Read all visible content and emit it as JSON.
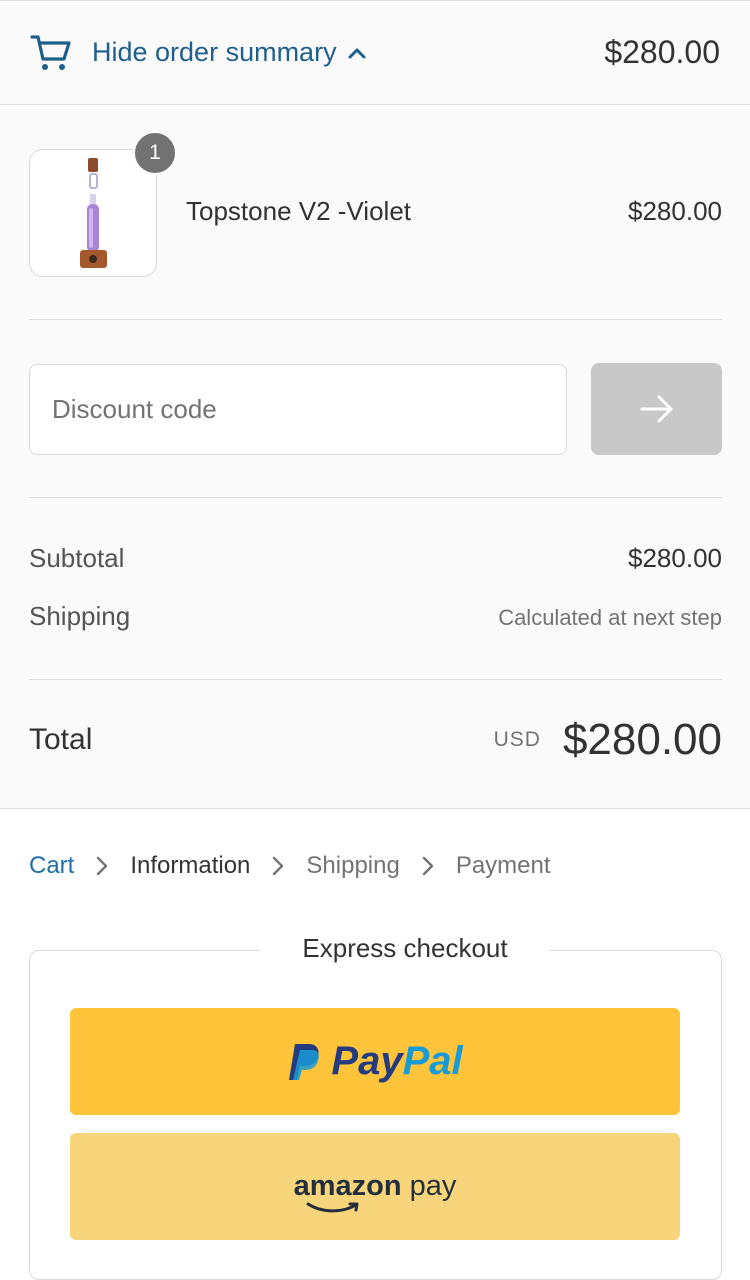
{
  "summary_toggle": {
    "label": "Hide order summary",
    "total": "$280.00",
    "icon": "cart-icon"
  },
  "product": {
    "name": "Topstone V2 -Violet",
    "price": "$280.00",
    "quantity": "1"
  },
  "discount": {
    "placeholder": "Discount code"
  },
  "lines": {
    "subtotal_label": "Subtotal",
    "subtotal_value": "$280.00",
    "shipping_label": "Shipping",
    "shipping_value": "Calculated at next step"
  },
  "total": {
    "label": "Total",
    "currency": "USD",
    "value": "$280.00"
  },
  "breadcrumb": {
    "cart": "Cart",
    "information": "Information",
    "shipping": "Shipping",
    "payment": "Payment"
  },
  "express": {
    "title": "Express checkout",
    "paypal_pay": "Pay",
    "paypal_pal": "Pal",
    "amazon_word": "amazon",
    "amazon_pay": "pay"
  },
  "colors": {
    "link": "#1f6fa6",
    "paypal_yellow": "#ffc439",
    "amazon_yellow": "#f8d47a"
  }
}
